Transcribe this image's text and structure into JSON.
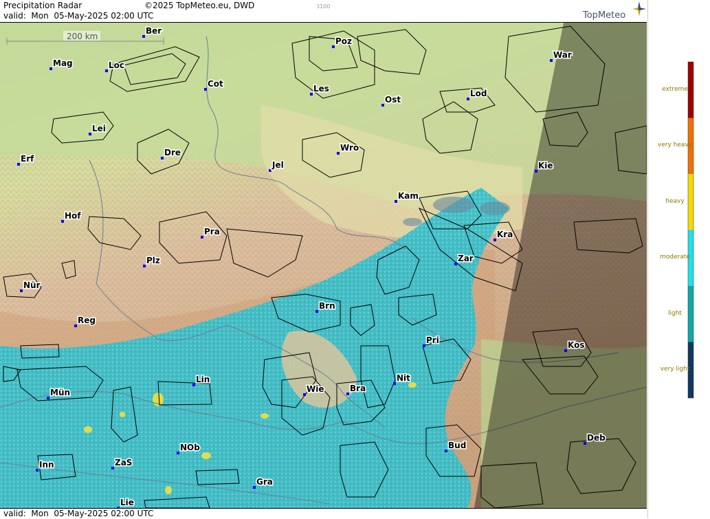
{
  "header": {
    "title": "Precipitation Radar",
    "copyright": "©2025 TopMeteo.eu, DWD",
    "valid": "valid:  Mon  05-May-2025 02:00 UTC",
    "code": "3100",
    "logo": "TopMeteo"
  },
  "footer": {
    "valid": "valid:  Mon  05-May-2025 02:00 UTC"
  },
  "scale": {
    "label": "200 km"
  },
  "cities": [
    {
      "name": "Ber"
    },
    {
      "name": "Poz"
    },
    {
      "name": "War"
    },
    {
      "name": "Mag"
    },
    {
      "name": "Loc"
    },
    {
      "name": "Cot"
    },
    {
      "name": "Les"
    },
    {
      "name": "Ost"
    },
    {
      "name": "Lod"
    },
    {
      "name": "Lei"
    },
    {
      "name": "Dre"
    },
    {
      "name": "Wro"
    },
    {
      "name": "Erf"
    },
    {
      "name": "Jel"
    },
    {
      "name": "Kie"
    },
    {
      "name": "Kam"
    },
    {
      "name": "Hof"
    },
    {
      "name": "Pra"
    },
    {
      "name": "Kra"
    },
    {
      "name": "Zar"
    },
    {
      "name": "Plz"
    },
    {
      "name": "Nür"
    },
    {
      "name": "Brn"
    },
    {
      "name": "Reg"
    },
    {
      "name": "Pri"
    },
    {
      "name": "Kos"
    },
    {
      "name": "Lin"
    },
    {
      "name": "Nit"
    },
    {
      "name": "Wie"
    },
    {
      "name": "Bra"
    },
    {
      "name": "Mün"
    },
    {
      "name": "NOb"
    },
    {
      "name": "Bud"
    },
    {
      "name": "Deb"
    },
    {
      "name": "Inn"
    },
    {
      "name": "ZaS"
    },
    {
      "name": "Gra"
    },
    {
      "name": "Lie"
    }
  ],
  "legend": {
    "levels": [
      {
        "label": "extreme",
        "color": "#a00000"
      },
      {
        "label": "very heavy",
        "color": "#f07000"
      },
      {
        "label": "heavy",
        "color": "#f8d800"
      },
      {
        "label": "moderate",
        "color": "#20e0e8"
      },
      {
        "label": "light",
        "color": "#10a8a8"
      },
      {
        "label": "very light",
        "color": "#103860"
      }
    ]
  },
  "colors": {
    "lowland": "#c8d89a",
    "highland": "#d9b89a",
    "precip_light": "#2bb9c6",
    "precip_moderate": "#40d8e0",
    "precip_heavy": "#f0e040",
    "night_overlay": "#000000"
  }
}
